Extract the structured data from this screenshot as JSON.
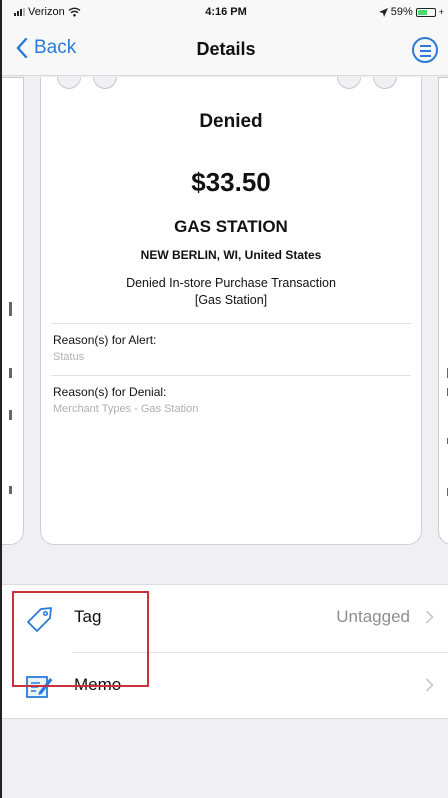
{
  "status_bar": {
    "carrier": "Verizon",
    "time": "4:16 PM",
    "battery_percent": "59%",
    "battery_level": 0.59,
    "colors": {
      "battery": "#4cd964"
    }
  },
  "nav": {
    "back_label": "Back",
    "title": "Details",
    "back_icon": "chevron-left-icon",
    "menu_icon": "menu-circle-icon",
    "accent": "#2a7bd8"
  },
  "card": {
    "status": "Denied",
    "amount": "$33.50",
    "merchant": "GAS STATION",
    "location": "NEW BERLIN, WI, United States",
    "transaction_line1": "Denied In-store  Purchase Transaction",
    "transaction_line2": "[Gas Station]",
    "alert_label": "Reason(s) for Alert:",
    "alert_value": "Status",
    "denial_label": "Reason(s) for Denial:",
    "denial_value": "Merchant Types - Gas Station"
  },
  "actions": {
    "tag": {
      "label": "Tag",
      "value": "Untagged",
      "icon": "tag-icon"
    },
    "memo": {
      "label": "Memo",
      "icon": "memo-edit-icon"
    }
  },
  "colors": {
    "highlight_border": "#c8323c"
  }
}
